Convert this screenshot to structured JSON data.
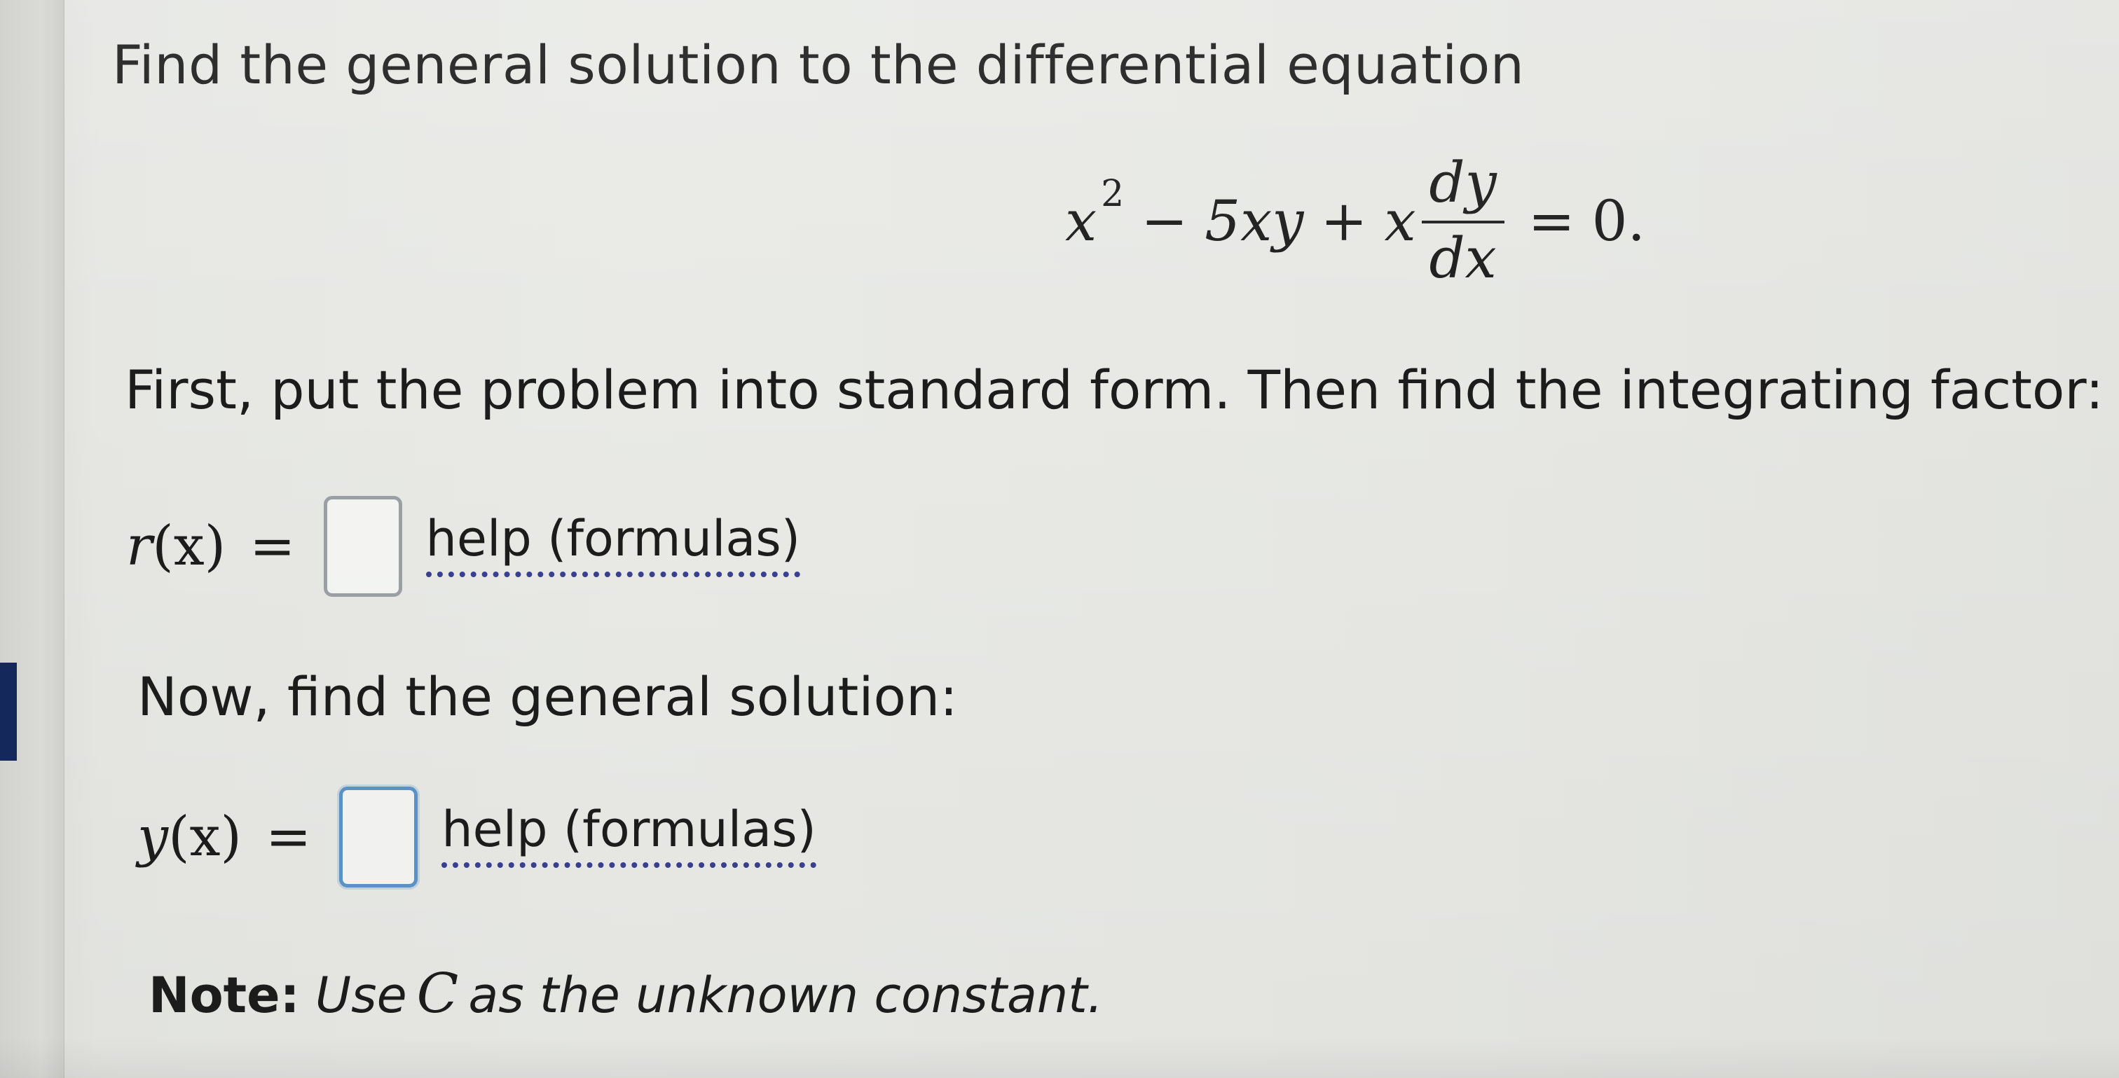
{
  "problem": {
    "prompt": "Find the general solution to the differential equation",
    "equation": {
      "x_var": "x",
      "exponent": "2",
      "minus": "−",
      "term2": "5xy",
      "plus": "+",
      "x_var2": "x",
      "numerator": "dy",
      "denominator": "dx",
      "equals": "=",
      "rhs": "0."
    }
  },
  "step1": {
    "instruction": "First, put the problem into standard form. Then find the integrating factor:",
    "func_name": "r",
    "func_arg": "(x)",
    "equals": "=",
    "input_value": "",
    "help_label": "help (formulas)"
  },
  "step2": {
    "instruction": "Now, find the general solution:",
    "func_name": "y",
    "func_arg": "(x)",
    "equals": "=",
    "input_value": "",
    "help_label": "help (formulas)"
  },
  "note": {
    "label": "Note:",
    "text_before": "Use",
    "constant": "C",
    "text_after": "as the unknown constant."
  },
  "colors": {
    "help_underline": "#3a3f8f",
    "active_box_border": "#5b93c9",
    "rail_tab": "#14285c"
  }
}
